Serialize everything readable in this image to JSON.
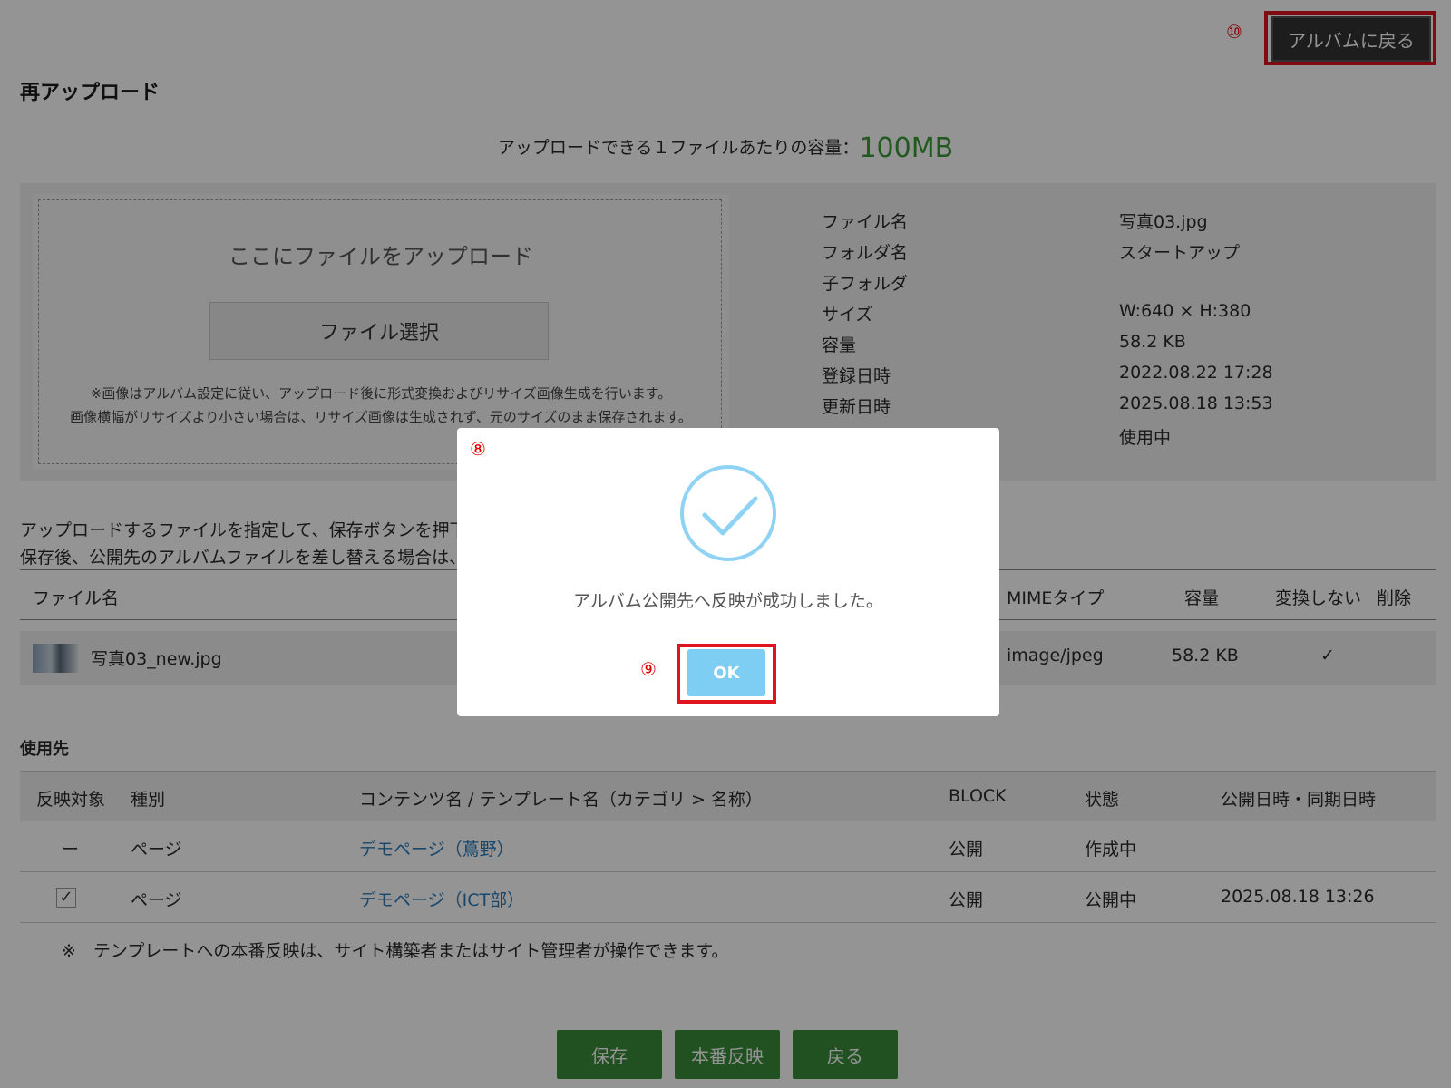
{
  "header": {
    "back_to_album": "アルバムに戻る",
    "callout_back": "⑩"
  },
  "page_title": "再アップロード",
  "limit": {
    "label": "アップロードできる１ファイルあたりの容量：",
    "value": "100MB"
  },
  "upload": {
    "drop_title": "ここにファイルをアップロード",
    "pick_button": "ファイル選択",
    "note1": "※画像はアルバム設定に従い、アップロード後に形式変換およびリサイズ画像生成を行います。",
    "note2": "画像横幅がリサイズより小さい場合は、リサイズ画像は生成されず、元のサイズのまま保存されます。"
  },
  "file_info": {
    "rows": [
      {
        "k": "ファイル名",
        "v": "写真03.jpg"
      },
      {
        "k": "フォルダ名",
        "v": "スタートアップ"
      },
      {
        "k": "子フォルダ",
        "v": ""
      },
      {
        "k": "サイズ",
        "v": "W:640 × H:380"
      },
      {
        "k": "容量",
        "v": "58.2 KB"
      },
      {
        "k": "登録日時",
        "v": "2022.08.22 17:28"
      },
      {
        "k": "更新日時",
        "v": "2025.08.18 13:53"
      },
      {
        "k": "",
        "v": "使用中"
      }
    ]
  },
  "instructions": {
    "line1": "アップロードするファイルを指定して、保存ボタンを押下",
    "line2": "保存後、公開先のアルバムファイルを差し替える場合は、"
  },
  "files_table": {
    "headers": {
      "name": "ファイル名",
      "mime": "MIMEタイプ",
      "size": "容量",
      "no_convert": "変換しない",
      "delete": "削除"
    },
    "row": {
      "name": "写真03_new.jpg",
      "mime": "image/jpeg",
      "size": "58.2 KB",
      "no_convert": "✓"
    }
  },
  "usage": {
    "title": "使用先",
    "headers": {
      "target": "反映対象",
      "type": "種別",
      "content": "コンテンツ名 / テンプレート名（カテゴリ > 名称）",
      "block": "BLOCK",
      "status": "状態",
      "date": "公開日時・同期日時"
    },
    "rows": [
      {
        "target": "ー",
        "type": "ページ",
        "content": "デモページ（蔦野）",
        "block": "公開",
        "status": "作成中",
        "date": ""
      },
      {
        "target": "✓",
        "type": "ページ",
        "content": "デモページ（ICT部）",
        "block": "公開",
        "status": "公開中",
        "date": "2025.08.18 13:26"
      }
    ],
    "footnote": "※　テンプレートへの本番反映は、サイト構築者またはサイト管理者が操作できます。"
  },
  "bottom_buttons": {
    "save": "保存",
    "publish": "本番反映",
    "back": "戻る"
  },
  "modal": {
    "callout_modal": "⑧",
    "message": "アルバム公開先へ反映が成功しました。",
    "callout_ok": "⑨",
    "ok": "OK"
  },
  "colors": {
    "accent_green": "#3a8a3a",
    "ok_blue": "#7ecef4",
    "callout_red": "#e0141e",
    "link_blue": "#2a7ab8"
  }
}
